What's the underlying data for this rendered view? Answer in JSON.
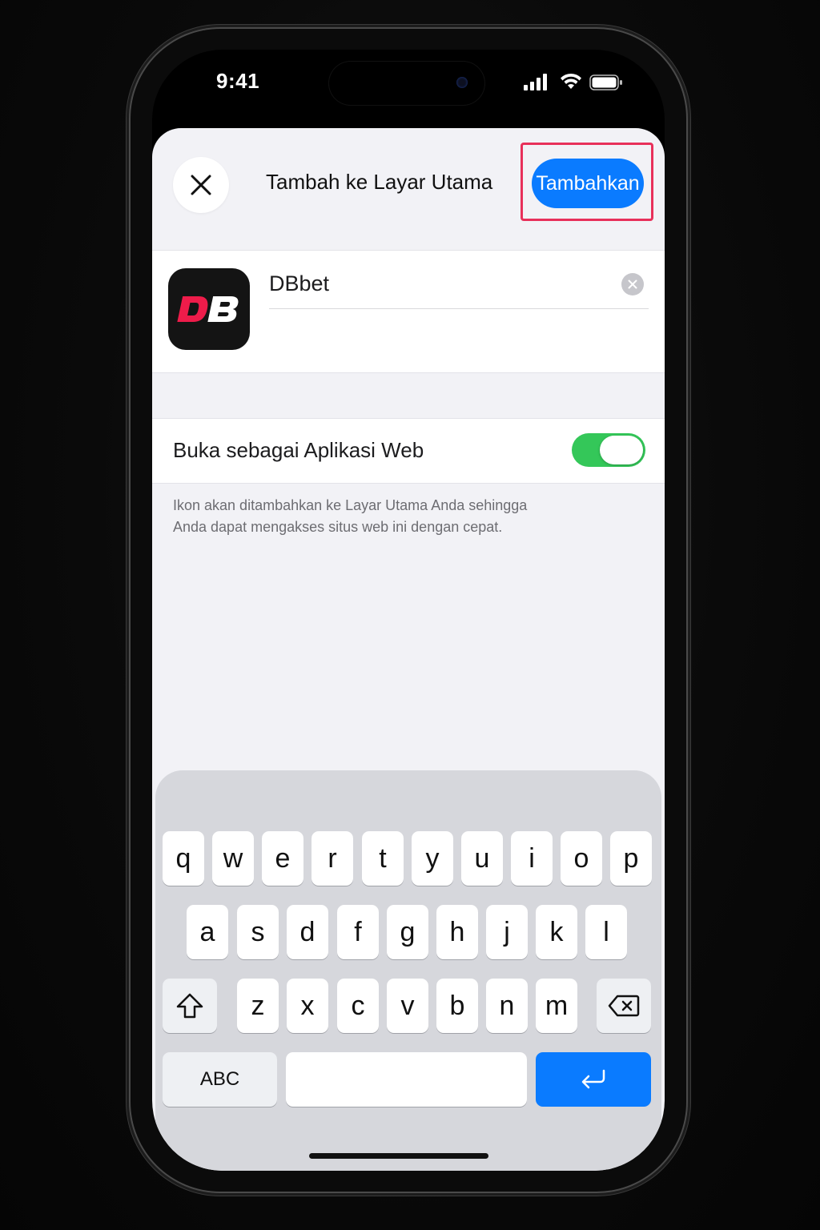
{
  "status_bar": {
    "time": "9:41"
  },
  "sheet": {
    "title": "Tambah ke Layar Utama",
    "add_button_label": "Tambahkan",
    "accent_color": "#0a7bff",
    "highlight_color": "#e8305a"
  },
  "app": {
    "icon_text": "DB",
    "name_value": "DBbet"
  },
  "web_app_toggle": {
    "label": "Buka sebagai Aplikasi Web",
    "on": true
  },
  "hint_text_line1": "Ikon akan ditambahkan ke Layar Utama Anda sehingga",
  "hint_text_line2": "Anda dapat mengakses situs web ini dengan cepat.",
  "keyboard": {
    "row1": [
      "q",
      "w",
      "e",
      "r",
      "t",
      "y",
      "u",
      "i",
      "o",
      "p"
    ],
    "row2": [
      "a",
      "s",
      "d",
      "f",
      "g",
      "h",
      "j",
      "k",
      "l"
    ],
    "row3": [
      "z",
      "x",
      "c",
      "v",
      "b",
      "n",
      "m"
    ],
    "abc_label": "ABC",
    "shift_icon": "shift-icon",
    "delete_icon": "delete-icon",
    "return_icon": "return-icon"
  }
}
